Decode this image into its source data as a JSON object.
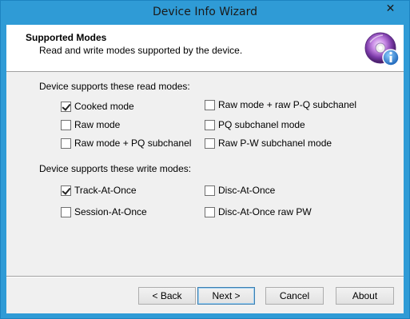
{
  "window": {
    "title": "Device Info Wizard",
    "close_glyph": "✕"
  },
  "header": {
    "title": "Supported Modes",
    "subtitle": "Read and write modes supported by the device.",
    "icon": "disc-info-icon"
  },
  "read_modes": {
    "label": "Device supports these read modes:",
    "items": [
      {
        "label": "Cooked mode",
        "checked": true
      },
      {
        "label": "Raw mode",
        "checked": false
      },
      {
        "label": "Raw mode + PQ subchanel",
        "checked": false
      },
      {
        "label": "Raw mode + raw P-Q subchanel",
        "checked": false
      },
      {
        "label": "PQ subchanel mode",
        "checked": false
      },
      {
        "label": "Raw P-W subchanel mode",
        "checked": false
      }
    ]
  },
  "write_modes": {
    "label": "Device supports these write modes:",
    "items": [
      {
        "label": "Track-At-Once",
        "checked": true
      },
      {
        "label": "Session-At-Once",
        "checked": false
      },
      {
        "label": "Disc-At-Once",
        "checked": false
      },
      {
        "label": "Disc-At-Once raw PW",
        "checked": false
      }
    ]
  },
  "buttons": {
    "back": "< Back",
    "next": "Next >",
    "cancel": "Cancel",
    "about": "About"
  },
  "colors": {
    "title_bar": "#2f9bd6",
    "client_bg": "#f0f0f0",
    "default_button_border": "#3c7fb1"
  }
}
